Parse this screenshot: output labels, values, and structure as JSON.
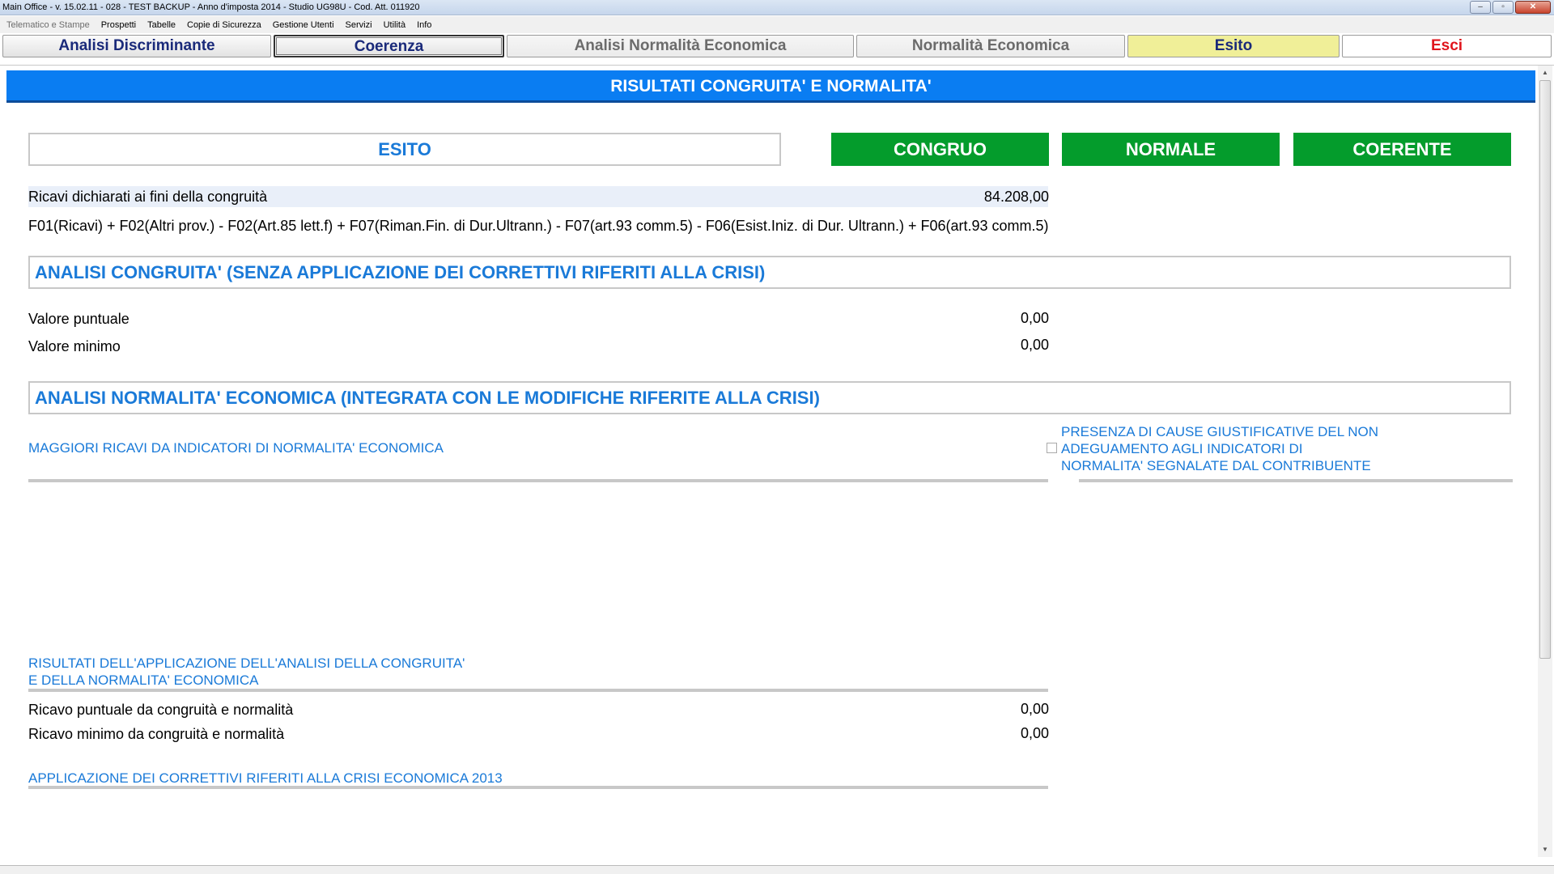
{
  "window": {
    "title": "Main Office - v. 15.02.11 - 028 - TEST BACKUP - Anno d'imposta 2014 - Studio UG98U - Cod. Att. 011920",
    "controls": [
      "–",
      "▫",
      "✕"
    ]
  },
  "menu": [
    "Telematico e Stampe",
    "Prospetti",
    "Tabelle",
    "Copie di Sicurezza",
    "Gestione Utenti",
    "Servizi",
    "Utilità",
    "Info"
  ],
  "toolbar": {
    "analisi_discriminante": "Analisi Discriminante",
    "coerenza": "Coerenza",
    "analisi_normalita": "Analisi Normalità Economica",
    "normalita": "Normalità Economica",
    "esito": "Esito",
    "esci": "Esci"
  },
  "banner": "RISULTATI CONGRUITA' E NORMALITA'",
  "esito": {
    "label": "ESITO",
    "congruo": "CONGRUO",
    "normale": "NORMALE",
    "coerente": "COERENTE"
  },
  "ricavi": {
    "label": "Ricavi dichiarati ai fini della congruità",
    "value": "84.208,00",
    "formula": "F01(Ricavi) + F02(Altri prov.) - F02(Art.85 lett.f) + F07(Riman.Fin. di Dur.Ultrann.) - F07(art.93 comm.5) - F06(Esist.Iniz. di Dur. Ultrann.) + F06(art.93 comm.5)"
  },
  "congruita": {
    "title": "ANALISI CONGRUITA' (SENZA APPLICAZIONE DEI CORRETTIVI RIFERITI ALLA CRISI)",
    "puntuale_label": "Valore puntuale",
    "puntuale_value": "0,00",
    "minimo_label": "Valore minimo",
    "minimo_value": "0,00"
  },
  "normalita": {
    "title": "ANALISI NORMALITA' ECONOMICA (INTEGRATA CON LE MODIFICHE RIFERITE ALLA CRISI)",
    "maggiori_ricavi": "MAGGIORI RICAVI DA INDICATORI DI NORMALITA' ECONOMICA",
    "cause_line1": "PRESENZA DI CAUSE GIUSTIFICATIVE DEL NON",
    "cause_line2": "ADEGUAMENTO AGLI INDICATORI DI",
    "cause_line3": "NORMALITA' SEGNALATE DAL CONTRIBUENTE"
  },
  "risultati": {
    "title_line1": "RISULTATI DELL'APPLICAZIONE DELL'ANALISI DELLA CONGRUITA'",
    "title_line2": "E DELLA NORMALITA' ECONOMICA",
    "puntuale_label": "Ricavo puntuale da congruità e normalità",
    "puntuale_value": "0,00",
    "minimo_label": "Ricavo minimo da congruità e normalità",
    "minimo_value": "0,00"
  },
  "correttivi": "APPLICAZIONE DEI CORRETTIVI RIFERITI ALLA CRISI ECONOMICA 2013",
  "colors": {
    "banner": "#0a7df2",
    "status_green": "#049c2c",
    "accent_blue": "#1a7ad8",
    "esito_yellow": "#f0ef98",
    "esci_red": "#e0141c"
  }
}
